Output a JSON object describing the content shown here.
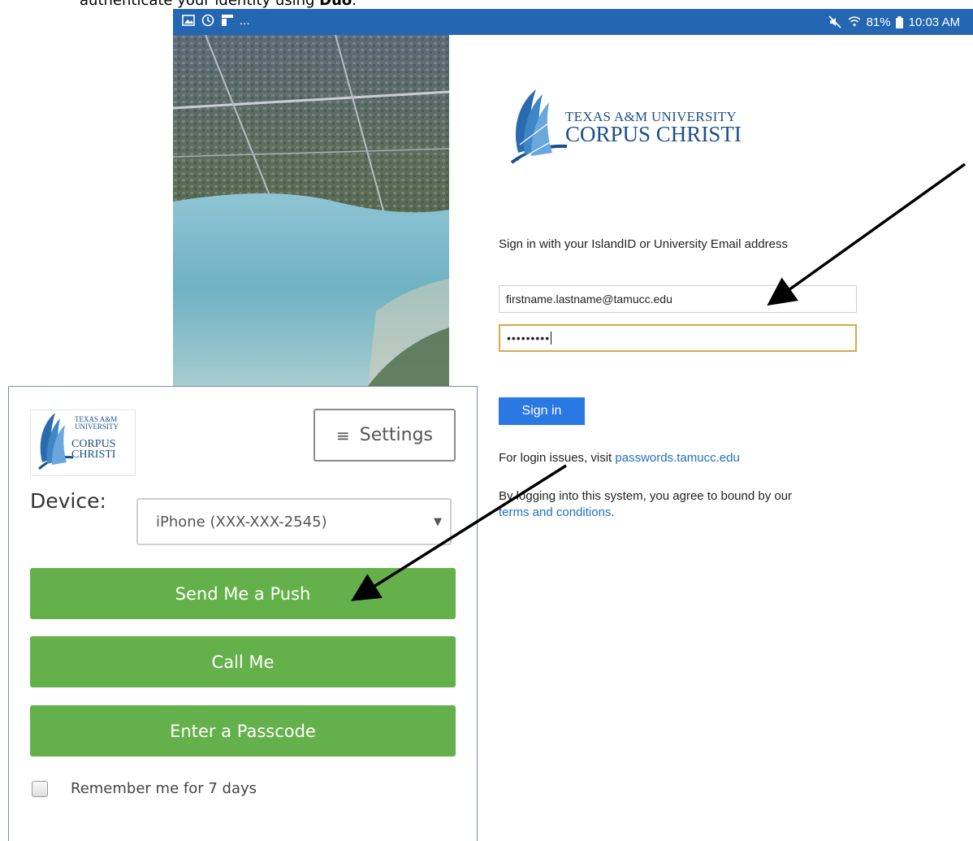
{
  "document": {
    "intro_text": "authenticate your identity using ",
    "intro_bold": "Duo",
    "intro_end": "."
  },
  "status_bar": {
    "left_icons": [
      "image-icon",
      "timer-icon",
      "app-icon"
    ],
    "left_more": "...",
    "battery": "81%",
    "time": "10:03 AM"
  },
  "signin": {
    "logo_line1": "TEXAS A&M UNIVERSITY",
    "logo_line2": "CORPUS CHRISTI",
    "prompt": "Sign in with your IslandID or University Email address",
    "username_value": "firstname.lastname@tamucc.edu",
    "password_value": "•••••••••",
    "button": "Sign in",
    "login_issues_prefix": "For login issues, visit ",
    "login_issues_link": "passwords.tamucc.edu",
    "agree_prefix": "By logging into this system, you agree to bound by our",
    "agree_link": "terms and conditions",
    "agree_suffix": "."
  },
  "duo": {
    "logo_line1": "TEXAS A&M\nUNIVERSITY",
    "logo_line2": "CORPUS\nCHRISTI",
    "settings": "Settings",
    "device_label": "Device:",
    "device_value": "iPhone (XXX-XXX-2545)",
    "buttons": [
      "Send Me a Push",
      "Call Me",
      "Enter a Passcode"
    ],
    "remember": "Remember me for 7 days"
  },
  "colors": {
    "status_bar": "#2566b2",
    "signin_button": "#2a78e4",
    "duo_button": "#64b14b",
    "password_focus": "#d8a847",
    "link": "#1f6fc4",
    "logo": "#1c4f8c"
  }
}
